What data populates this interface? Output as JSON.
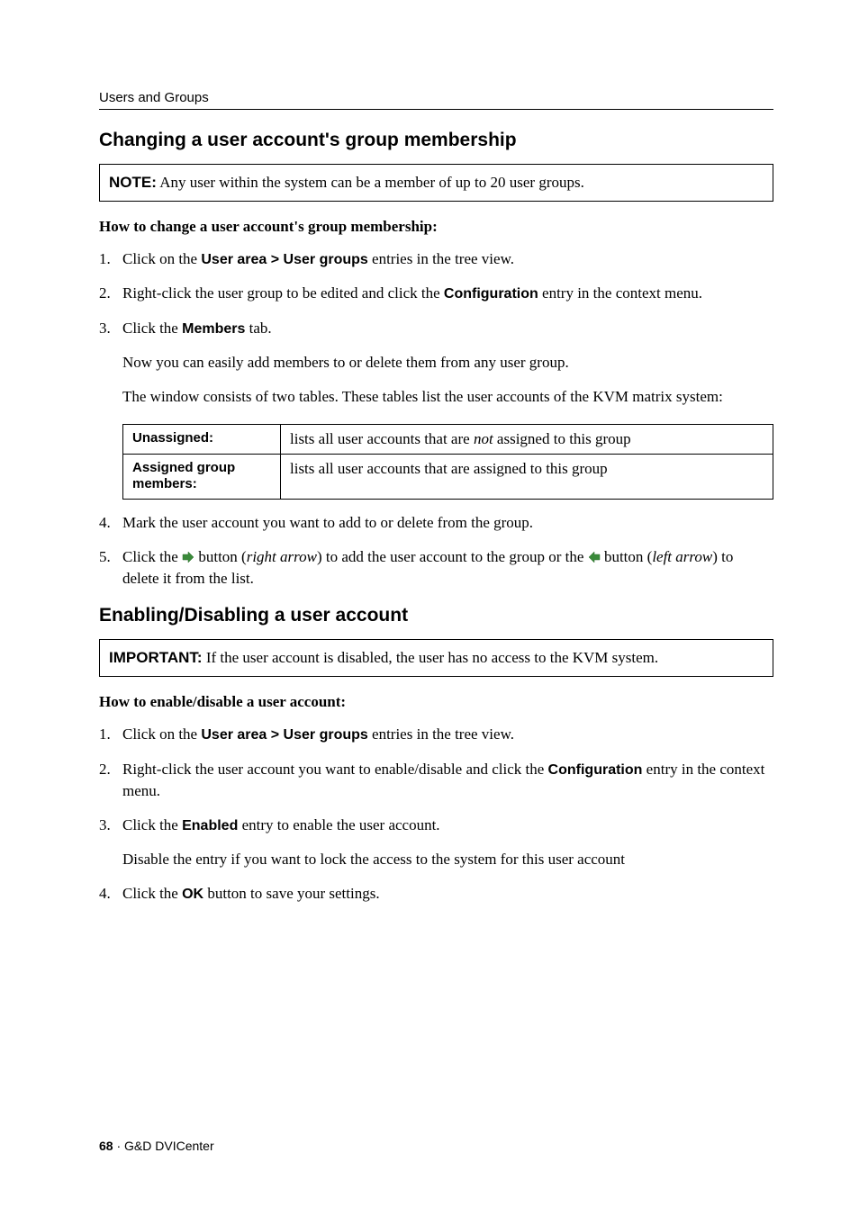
{
  "running_head": "Users and Groups",
  "section1": {
    "heading": "Changing a user account's group membership",
    "note_label": "NOTE:",
    "note_text": " Any user within the system can be a member of up to 20 user groups.",
    "howto": "How to change a user account's group membership:",
    "step1_a": "Click on the ",
    "step1_b": "User area > User groups",
    "step1_c": " entries in the tree view.",
    "step2_a": "Right-click the user group to be edited and click the ",
    "step2_b": "Configuration",
    "step2_c": " entry in the context menu.",
    "step3_a": "Click the ",
    "step3_b": "Members",
    "step3_c": " tab.",
    "step3_p1": "Now you can easily add members to or delete them from any user group.",
    "step3_p2": "The window consists of two tables. These tables list the user accounts of the KVM matrix system:",
    "table": {
      "r1_term": "Unassigned:",
      "r1_def_a": "lists all user accounts that are ",
      "r1_def_b": "not",
      "r1_def_c": " assigned to this group",
      "r2_term": "Assigned group members:",
      "r2_def": "lists all user accounts that are assigned to this group"
    },
    "step4": "Mark the user account you want to add to or delete from the group.",
    "step5_a": "Click the ",
    "step5_b": " button (",
    "step5_c": "right arrow",
    "step5_d": ") to add the user account to the group or the ",
    "step5_e": " button (",
    "step5_f": "left arrow",
    "step5_g": ") to delete it from the list."
  },
  "section2": {
    "heading": "Enabling/Disabling a user account",
    "note_label": "IMPORTANT:",
    "note_text": " If the user account is disabled, the user has no access to the KVM system.",
    "howto": "How to enable/disable a user account:",
    "step1_a": "Click on the ",
    "step1_b": "User area > User groups",
    "step1_c": " entries in the tree view.",
    "step2_a": "Right-click the user account you want to enable/disable and click the ",
    "step2_b": "Configuration",
    "step2_c": " entry in the context menu.",
    "step3_a": "Click the ",
    "step3_b": "Enabled",
    "step3_c": " entry to enable the user account.",
    "step3_p1": "Disable the entry if you want to lock the access to the system for this user account",
    "step4_a": "Click the ",
    "step4_b": "OK",
    "step4_c": " button to save your settings."
  },
  "footer": {
    "pagenum": "68",
    "sep": " · ",
    "doc": "G&D DVICenter"
  }
}
